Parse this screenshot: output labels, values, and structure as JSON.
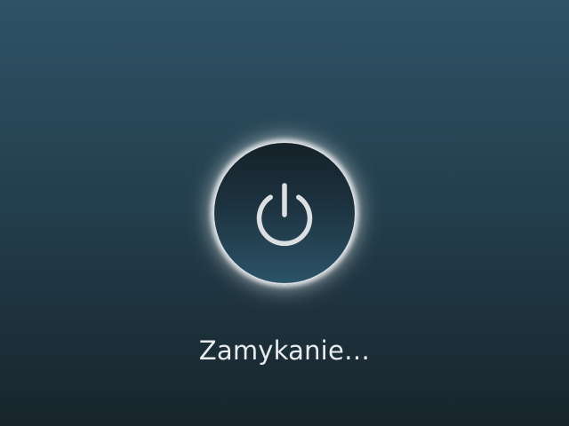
{
  "screen": {
    "status_text": "Zamykanie…",
    "icon": "power-icon"
  },
  "colors": {
    "background_top": "#2e5366",
    "background_bottom": "#18252c",
    "circle_border": "#d8dde0",
    "icon": "#dcdfe1",
    "text": "#e9ecee"
  }
}
